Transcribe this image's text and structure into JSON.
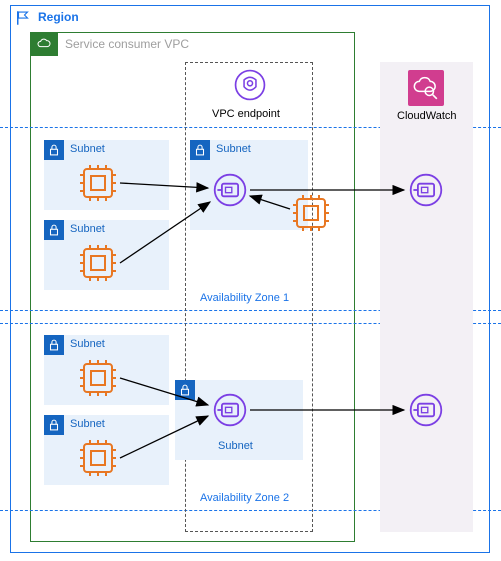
{
  "region": {
    "label": "Region"
  },
  "vpc": {
    "label": "Service consumer VPC"
  },
  "endpoint": {
    "label": "VPC endpoint"
  },
  "cloudwatch": {
    "label": "CloudWatch"
  },
  "az1": {
    "label": "Availability Zone 1"
  },
  "az2": {
    "label": "Availability Zone 2"
  },
  "subnetLabel": "Subnet"
}
